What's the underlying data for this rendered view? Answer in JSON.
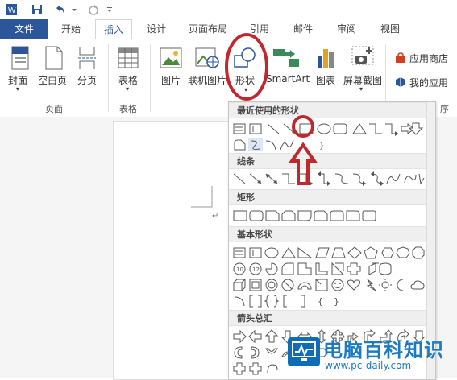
{
  "tabs": {
    "file": "文件",
    "home": "开始",
    "insert": "插入",
    "design": "设计",
    "layout": "页面布局",
    "references": "引用",
    "mailings": "邮件",
    "review": "审阅",
    "view": "视图"
  },
  "ribbon": {
    "cover": "封面",
    "blank_page": "空白页",
    "page_break": "分页",
    "group_pages": "页面",
    "table": "表格",
    "group_tables": "表格",
    "picture": "图片",
    "online_picture": "联机图片",
    "shapes": "形状",
    "smartart": "SmartArt",
    "chart": "图表",
    "screenshot": "屏幕截图",
    "app_store": "应用商店",
    "my_apps": "我的应用",
    "group_apps_partial": "序"
  },
  "shapes_menu": {
    "recent": "最近使用的形状",
    "lines": "线条",
    "rectangles": "矩形",
    "basic": "基本形状",
    "arrows": "箭头总汇"
  },
  "watermark": {
    "title": "电脑百科知识",
    "url": "www.pc-daily.com"
  },
  "colors": {
    "accent": "#2b579a",
    "highlight": "#c0282e",
    "watermark": "#1a7ac4"
  }
}
